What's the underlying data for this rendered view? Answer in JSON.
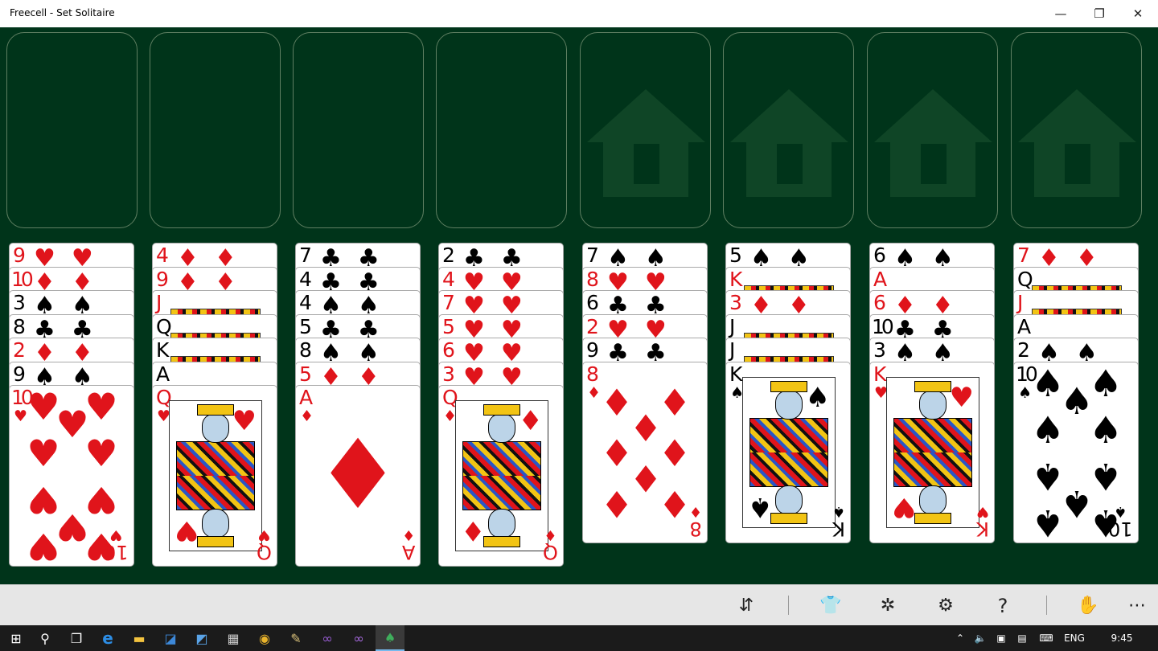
{
  "window": {
    "title": "Freecell - Set Solitaire",
    "minimize_icon": "minimize-icon",
    "maximize_icon": "restore-icon",
    "close_icon": "close-icon"
  },
  "colors": {
    "table": "#00341a",
    "slot_border": "#5f7f62",
    "red_suit": "#e0141b",
    "black_suit": "#000000",
    "toolbar": "#e6e6e6",
    "taskbar": "#1b1b1b"
  },
  "free_cells": [
    {
      "id": "freecell-1",
      "card": null
    },
    {
      "id": "freecell-2",
      "card": null
    },
    {
      "id": "freecell-3",
      "card": null
    },
    {
      "id": "freecell-4",
      "card": null
    }
  ],
  "foundations": [
    {
      "id": "foundation-1",
      "icon": "home-icon",
      "card": null
    },
    {
      "id": "foundation-2",
      "icon": "home-icon",
      "card": null
    },
    {
      "id": "foundation-3",
      "icon": "home-icon",
      "card": null
    },
    {
      "id": "foundation-4",
      "icon": "home-icon",
      "card": null
    }
  ],
  "tableau": [
    {
      "column": 1,
      "cards": [
        {
          "rank": "9",
          "suit": "hearts"
        },
        {
          "rank": "10",
          "suit": "diamonds"
        },
        {
          "rank": "3",
          "suit": "spades"
        },
        {
          "rank": "8",
          "suit": "clubs"
        },
        {
          "rank": "2",
          "suit": "diamonds"
        },
        {
          "rank": "9",
          "suit": "spades"
        },
        {
          "rank": "10",
          "suit": "hearts"
        }
      ]
    },
    {
      "column": 2,
      "cards": [
        {
          "rank": "4",
          "suit": "diamonds"
        },
        {
          "rank": "9",
          "suit": "diamonds"
        },
        {
          "rank": "J",
          "suit": "hearts"
        },
        {
          "rank": "Q",
          "suit": "clubs"
        },
        {
          "rank": "K",
          "suit": "spades"
        },
        {
          "rank": "A",
          "suit": "clubs"
        },
        {
          "rank": "Q",
          "suit": "hearts"
        }
      ]
    },
    {
      "column": 3,
      "cards": [
        {
          "rank": "7",
          "suit": "clubs"
        },
        {
          "rank": "4",
          "suit": "clubs"
        },
        {
          "rank": "4",
          "suit": "spades"
        },
        {
          "rank": "5",
          "suit": "clubs"
        },
        {
          "rank": "8",
          "suit": "spades"
        },
        {
          "rank": "5",
          "suit": "diamonds"
        },
        {
          "rank": "A",
          "suit": "diamonds"
        }
      ]
    },
    {
      "column": 4,
      "cards": [
        {
          "rank": "2",
          "suit": "clubs"
        },
        {
          "rank": "4",
          "suit": "hearts"
        },
        {
          "rank": "7",
          "suit": "hearts"
        },
        {
          "rank": "5",
          "suit": "hearts"
        },
        {
          "rank": "6",
          "suit": "hearts"
        },
        {
          "rank": "3",
          "suit": "hearts"
        },
        {
          "rank": "Q",
          "suit": "diamonds"
        }
      ]
    },
    {
      "column": 5,
      "cards": [
        {
          "rank": "7",
          "suit": "spades"
        },
        {
          "rank": "8",
          "suit": "hearts"
        },
        {
          "rank": "6",
          "suit": "clubs"
        },
        {
          "rank": "2",
          "suit": "hearts"
        },
        {
          "rank": "9",
          "suit": "clubs"
        },
        {
          "rank": "8",
          "suit": "diamonds"
        }
      ]
    },
    {
      "column": 6,
      "cards": [
        {
          "rank": "5",
          "suit": "spades"
        },
        {
          "rank": "K",
          "suit": "diamonds"
        },
        {
          "rank": "3",
          "suit": "diamonds"
        },
        {
          "rank": "J",
          "suit": "spades"
        },
        {
          "rank": "J",
          "suit": "clubs"
        },
        {
          "rank": "K",
          "suit": "spades"
        }
      ]
    },
    {
      "column": 7,
      "cards": [
        {
          "rank": "6",
          "suit": "spades"
        },
        {
          "rank": "A",
          "suit": "hearts"
        },
        {
          "rank": "6",
          "suit": "diamonds"
        },
        {
          "rank": "10",
          "suit": "clubs"
        },
        {
          "rank": "3",
          "suit": "spades"
        },
        {
          "rank": "K",
          "suit": "hearts"
        }
      ]
    },
    {
      "column": 8,
      "cards": [
        {
          "rank": "7",
          "suit": "diamonds"
        },
        {
          "rank": "Q",
          "suit": "spades"
        },
        {
          "rank": "J",
          "suit": "diamonds"
        },
        {
          "rank": "A",
          "suit": "spades"
        },
        {
          "rank": "2",
          "suit": "spades"
        },
        {
          "rank": "10",
          "suit": "spades"
        }
      ]
    }
  ],
  "toolbar": [
    {
      "name": "hint-button",
      "icon": "hint-icon",
      "glyph": "⇵"
    },
    {
      "name": "card-back-button",
      "icon": "shirt-icon",
      "glyph": "👕"
    },
    {
      "name": "new-game-button",
      "icon": "shuffle-icon",
      "glyph": "✲"
    },
    {
      "name": "settings-button",
      "icon": "gear-icon",
      "glyph": "⚙"
    },
    {
      "name": "help-button",
      "icon": "help-icon",
      "glyph": "?"
    },
    {
      "name": "auto-play-button",
      "icon": "hand-icon",
      "glyph": "✋"
    },
    {
      "name": "more-button",
      "icon": "more-icon",
      "glyph": "⋯"
    }
  ],
  "taskbar": {
    "apps": [
      {
        "name": "start-button",
        "icon": "windows-icon",
        "glyph": "⊞",
        "color": "#ffffff"
      },
      {
        "name": "search-button",
        "icon": "search-icon",
        "glyph": "⚲",
        "color": "#ffffff"
      },
      {
        "name": "task-view-button",
        "icon": "task-view-icon",
        "glyph": "❐",
        "color": "#ffffff"
      },
      {
        "name": "edge-button",
        "icon": "edge-icon",
        "glyph": "e",
        "color": "#2d8ee6"
      },
      {
        "name": "file-explorer-button",
        "icon": "folder-icon",
        "glyph": "▬",
        "color": "#f3c33f"
      },
      {
        "name": "app-button-1",
        "icon": "app-icon",
        "glyph": "◪",
        "color": "#3d88d8"
      },
      {
        "name": "app-button-2",
        "icon": "app-icon",
        "glyph": "◩",
        "color": "#5aa4e8"
      },
      {
        "name": "calculator-button",
        "icon": "calculator-icon",
        "glyph": "▦",
        "color": "#cccccc"
      },
      {
        "name": "chrome-button",
        "icon": "chrome-icon",
        "glyph": "◉",
        "color": "#e8b32b"
      },
      {
        "name": "app-button-3",
        "icon": "tools-icon",
        "glyph": "✎",
        "color": "#d8c07a"
      },
      {
        "name": "visual-studio-button-1",
        "icon": "visual-studio-icon",
        "glyph": "∞",
        "color": "#9b5ed6"
      },
      {
        "name": "visual-studio-button-2",
        "icon": "visual-studio-icon",
        "glyph": "∞",
        "color": "#a86ae0"
      },
      {
        "name": "freecell-taskbar-button",
        "icon": "spade-icon",
        "glyph": "♠",
        "color": "#3fae5c"
      }
    ],
    "tray": {
      "up_arrow_icon": "chevron-up-icon",
      "volume_icon": "volume-icon",
      "network_icon": "network-icon",
      "notification_icon": "message-icon",
      "keyboard_icon": "keyboard-icon",
      "language": "ENG",
      "time": "9:45"
    }
  }
}
